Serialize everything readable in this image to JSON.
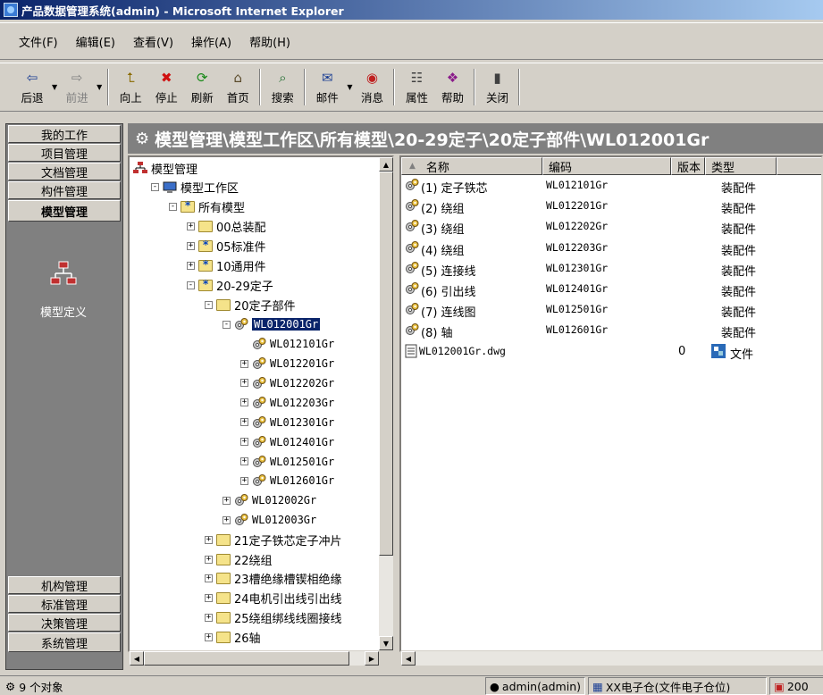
{
  "window": {
    "title": "产品数据管理系统(admin) - Microsoft Internet Explorer"
  },
  "menu": [
    "文件(F)",
    "编辑(E)",
    "查看(V)",
    "操作(A)",
    "帮助(H)"
  ],
  "toolbar": [
    {
      "label": "后退",
      "icon": "back-arrow-icon",
      "glyph": "⇦",
      "color": "#1c3f94",
      "enabled": true,
      "dropdown": true
    },
    {
      "label": "前进",
      "icon": "forward-arrow-icon",
      "glyph": "⇨",
      "color": "#808080",
      "enabled": false,
      "dropdown": true
    },
    {
      "label": "向上",
      "icon": "folder-up-icon",
      "glyph": "⮤",
      "color": "#8a6a00",
      "enabled": true
    },
    {
      "label": "停止",
      "icon": "stop-icon",
      "glyph": "✖",
      "color": "#d01010",
      "enabled": true
    },
    {
      "label": "刷新",
      "icon": "refresh-icon",
      "glyph": "⟳",
      "color": "#1a8a1a",
      "enabled": true
    },
    {
      "label": "首页",
      "icon": "home-icon",
      "glyph": "⌂",
      "color": "#5a4a2a",
      "enabled": true
    },
    {
      "label": "搜索",
      "icon": "search-icon",
      "glyph": "⌕",
      "color": "#1a6a2a",
      "enabled": true
    },
    {
      "label": "邮件",
      "icon": "mail-icon",
      "glyph": "✉",
      "color": "#1c3f94",
      "enabled": true,
      "dropdown": true
    },
    {
      "label": "消息",
      "icon": "message-icon",
      "glyph": "◉",
      "color": "#c02020",
      "enabled": true
    },
    {
      "label": "属性",
      "icon": "properties-icon",
      "glyph": "☷",
      "color": "#404040",
      "enabled": true
    },
    {
      "label": "帮助",
      "icon": "help-book-icon",
      "glyph": "❖",
      "color": "#8a1a8a",
      "enabled": true
    },
    {
      "label": "关闭",
      "icon": "close-door-icon",
      "glyph": "▮",
      "color": "#404040",
      "enabled": true
    }
  ],
  "nav": {
    "top": [
      "我的工作",
      "项目管理",
      "文档管理",
      "构件管理",
      "模型管理"
    ],
    "active": "模型管理",
    "sub_item": "模型定义",
    "bottom": [
      "机构管理",
      "标准管理",
      "决策管理",
      "系统管理"
    ]
  },
  "path": "模型管理\\模型工作区\\所有模型\\20-29定子\\20定子部件\\WL012001Gr",
  "tree": [
    {
      "label": "模型管理",
      "level": 0,
      "icon": "network",
      "exp": ""
    },
    {
      "label": "模型工作区",
      "level": 1,
      "icon": "computer",
      "exp": "-"
    },
    {
      "label": "所有模型",
      "level": 2,
      "icon": "starfolder",
      "exp": "-"
    },
    {
      "label": "00总装配",
      "level": 3,
      "icon": "folder",
      "exp": "+"
    },
    {
      "label": "05标准件",
      "level": 3,
      "icon": "starfolder",
      "exp": "+"
    },
    {
      "label": "10通用件",
      "level": 3,
      "icon": "starfolder",
      "exp": "+"
    },
    {
      "label": "20-29定子",
      "level": 3,
      "icon": "starfolder",
      "exp": "-"
    },
    {
      "label": "20定子部件",
      "level": 4,
      "icon": "folder",
      "exp": "-"
    },
    {
      "label": "WL012001Gr",
      "level": 5,
      "icon": "gear",
      "exp": "-",
      "selected": true
    },
    {
      "label": "WL012101Gr",
      "level": 6,
      "icon": "gear",
      "exp": ""
    },
    {
      "label": "WL012201Gr",
      "level": 6,
      "icon": "gear",
      "exp": "+"
    },
    {
      "label": "WL012202Gr",
      "level": 6,
      "icon": "gear",
      "exp": "+"
    },
    {
      "label": "WL012203Gr",
      "level": 6,
      "icon": "gear",
      "exp": "+"
    },
    {
      "label": "WL012301Gr",
      "level": 6,
      "icon": "gear",
      "exp": "+"
    },
    {
      "label": "WL012401Gr",
      "level": 6,
      "icon": "gear",
      "exp": "+"
    },
    {
      "label": "WL012501Gr",
      "level": 6,
      "icon": "gear",
      "exp": "+"
    },
    {
      "label": "WL012601Gr",
      "level": 6,
      "icon": "gear",
      "exp": "+"
    },
    {
      "label": "WL012002Gr",
      "level": 5,
      "icon": "gear",
      "exp": "+"
    },
    {
      "label": "WL012003Gr",
      "level": 5,
      "icon": "gear",
      "exp": "+"
    },
    {
      "label": "21定子铁芯定子冲片",
      "level": 4,
      "icon": "folder",
      "exp": "+"
    },
    {
      "label": "22绕组",
      "level": 4,
      "icon": "folder",
      "exp": "+"
    },
    {
      "label": "23槽绝缘槽锲相绝缘",
      "level": 4,
      "icon": "folder",
      "exp": "+"
    },
    {
      "label": "24电机引出线引出线",
      "level": 4,
      "icon": "folder",
      "exp": "+"
    },
    {
      "label": "25绕组绑线线圈接线",
      "level": 4,
      "icon": "folder",
      "exp": "+"
    },
    {
      "label": "26轴",
      "level": 4,
      "icon": "folder",
      "exp": "+"
    }
  ],
  "list": {
    "columns": [
      "名称",
      "编码",
      "版本",
      "类型"
    ],
    "rows": [
      {
        "name": "(1) 定子铁芯",
        "code": "WL012101Gr",
        "version": "",
        "type": "装配件",
        "icon": "gear"
      },
      {
        "name": "(2) 绕组",
        "code": "WL012201Gr",
        "version": "",
        "type": "装配件",
        "icon": "gear"
      },
      {
        "name": "(3) 绕组",
        "code": "WL012202Gr",
        "version": "",
        "type": "装配件",
        "icon": "gear"
      },
      {
        "name": "(4) 绕组",
        "code": "WL012203Gr",
        "version": "",
        "type": "装配件",
        "icon": "gear"
      },
      {
        "name": "(5) 连接线",
        "code": "WL012301Gr",
        "version": "",
        "type": "装配件",
        "icon": "gear"
      },
      {
        "name": "(6) 引出线",
        "code": "WL012401Gr",
        "version": "",
        "type": "装配件",
        "icon": "gear"
      },
      {
        "name": "(7) 连线图",
        "code": "WL012501Gr",
        "version": "",
        "type": "装配件",
        "icon": "gear"
      },
      {
        "name": "(8) 轴",
        "code": "WL012601Gr",
        "version": "",
        "type": "装配件",
        "icon": "gear"
      },
      {
        "name": "WL012001Gr.dwg",
        "code": "",
        "version": "0",
        "type": "文件",
        "icon": "document"
      }
    ]
  },
  "status": {
    "count": "9 个对象",
    "user": "admin(admin)",
    "zone": "XX电子仓(文件电子仓位)",
    "extra": "200"
  },
  "colors": {
    "title_start": "#0a246a",
    "title_end": "#a6caf0",
    "selection": "#0a246a",
    "panel_gray": "#808080"
  }
}
